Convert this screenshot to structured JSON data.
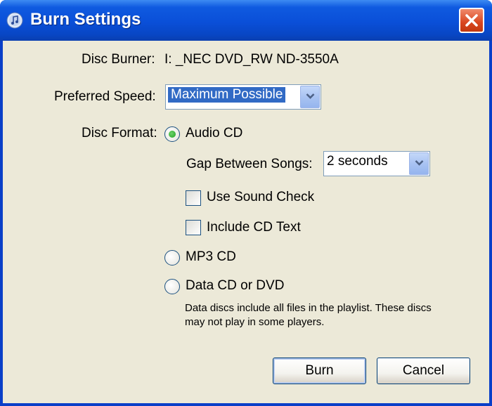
{
  "window": {
    "title": "Burn Settings"
  },
  "disc_burner": {
    "label": "Disc Burner:",
    "value": "I: _NEC DVD_RW ND-3550A"
  },
  "preferred_speed": {
    "label": "Preferred Speed:",
    "selected": "Maximum Possible"
  },
  "disc_format": {
    "label": "Disc Format:",
    "options": {
      "audio_cd": {
        "label": "Audio CD",
        "checked": true
      },
      "mp3_cd": {
        "label": "MP3 CD",
        "checked": false
      },
      "data_cd_dvd": {
        "label": "Data CD or DVD",
        "checked": false
      }
    },
    "gap": {
      "label": "Gap Between Songs:",
      "selected": "2 seconds"
    },
    "use_sound_check": {
      "label": "Use Sound Check",
      "checked": false
    },
    "include_cd_text": {
      "label": "Include CD Text",
      "checked": false
    },
    "data_note": "Data discs include all files in the playlist. These discs may not play in some players."
  },
  "buttons": {
    "burn": "Burn",
    "cancel": "Cancel"
  },
  "icons": {
    "app": "itunes-app-icon",
    "close": "close-icon",
    "dropdown": "chevron-down-icon"
  }
}
